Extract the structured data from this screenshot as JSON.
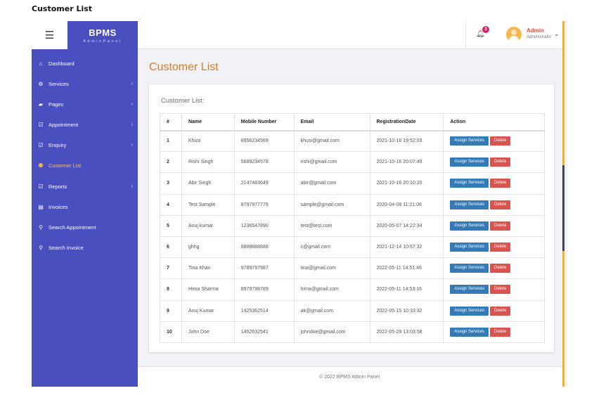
{
  "window_title": "Customer List",
  "brand": {
    "title": "BPMS",
    "subtitle": "AdminPanel"
  },
  "header": {
    "notification_count": "3",
    "user_name": "Admin",
    "user_role": "Administrator"
  },
  "sidebar": {
    "items": [
      {
        "label": "Dashboard",
        "icon": "home-icon",
        "glyph": "⌂",
        "caret": ""
      },
      {
        "label": "Services",
        "icon": "gears-icon",
        "glyph": "⚙",
        "caret": "‹"
      },
      {
        "label": "Pages",
        "icon": "book-icon",
        "glyph": "▰",
        "caret": "‹"
      },
      {
        "label": "Appointment",
        "icon": "check-square-icon",
        "glyph": "☑",
        "caret": "‹"
      },
      {
        "label": "Enquiry",
        "icon": "check-square-icon",
        "glyph": "☑",
        "caret": "‹"
      },
      {
        "label": "Customer List",
        "icon": "users-icon",
        "glyph": "⚉",
        "caret": ""
      },
      {
        "label": "Reports",
        "icon": "check-square-icon",
        "glyph": "☑",
        "caret": "‹"
      },
      {
        "label": "Invoices",
        "icon": "file-icon",
        "glyph": "▤",
        "caret": ""
      },
      {
        "label": "Search Appointment",
        "icon": "search-icon",
        "glyph": "⚲",
        "caret": ""
      },
      {
        "label": "Search Invoice",
        "icon": "search-icon",
        "glyph": "⚲",
        "caret": ""
      }
    ]
  },
  "main": {
    "page_title": "Customer List",
    "card_title": "Customer List:",
    "table": {
      "headers": [
        "#",
        "Name",
        "Mobile Number",
        "Email",
        "RegistrationDate",
        "Action"
      ],
      "rows": [
        [
          "1",
          "Khusi",
          "8956234569",
          "khusi@gmail.com",
          "2021-10-16 19:52:03"
        ],
        [
          "2",
          "Rishi Singh",
          "5689234578",
          "rishi@gmail.com",
          "2021-10-16 20:07:49"
        ],
        [
          "3",
          "Abir Singh",
          "2147483649",
          "abir@gmail.com",
          "2021-10-16 20:10:20"
        ],
        [
          "4",
          "Test Sample",
          "8797977779",
          "sample@gmail.com",
          "2020-04-08 11:21:06"
        ],
        [
          "5",
          "Anuj kumar",
          "1236547890",
          "test@test.com",
          "2020-05-07 14:22:34"
        ],
        [
          "6",
          "ghhg",
          "8888888888",
          "c@gmail.com",
          "2021-12-14 10:57:32"
        ],
        [
          "7",
          "Tina Khan",
          "9789797987",
          "tina@gmail.com",
          "2022-05-11 14:51:46"
        ],
        [
          "8",
          "Hima Sharma",
          "8979798789",
          "hima@gmail.com",
          "2022-05-11 14:53:16"
        ],
        [
          "9",
          "Anuj Kumar",
          "1425362514",
          "ak@gmail.com",
          "2022-05-15 10:33:32"
        ],
        [
          "10",
          "John Doe",
          "1452632541",
          "johndoe@gmail.com",
          "2022-05-29 13:03:58"
        ]
      ],
      "assign_label": "Assign Services",
      "delete_label": "Delete"
    }
  },
  "footer": {
    "text": "© 2022 BPMS Admin Panel."
  },
  "colors": {
    "sidebar": "#4a4fbf",
    "accent_title": "#e07a22",
    "active_nav": "#f7c14d",
    "assign_button": "#337ab7",
    "delete_button": "#d9534f"
  }
}
